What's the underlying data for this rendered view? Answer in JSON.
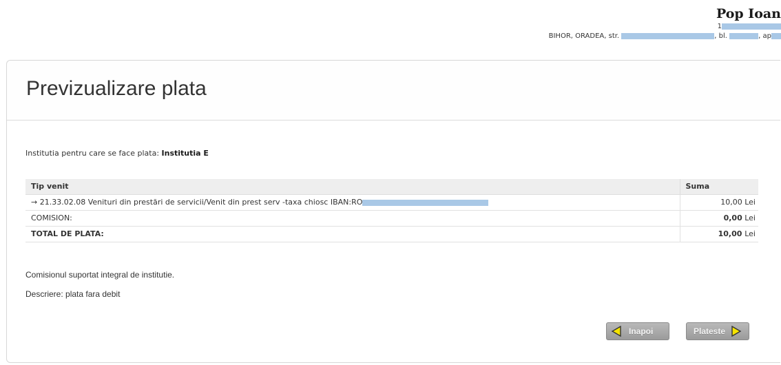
{
  "user": {
    "name": "Pop Ioan",
    "id_prefix": "1",
    "address_county_city": "BIHOR, ORADEA, str.",
    "address_bl": ", bl.",
    "address_ap": ", ap"
  },
  "page": {
    "title": "Previzualizare plata"
  },
  "institution": {
    "label": "Institutia pentru care se face plata:",
    "name": "Institutia E"
  },
  "table": {
    "headers": {
      "type": "Tip venit",
      "amount": "Suma"
    },
    "item": {
      "description": "→ 21.33.02.08 Venituri din prestări de servicii/Venit din prest serv -taxa chiosc IBAN:RO",
      "amount": "10,00",
      "currency": "Lei"
    },
    "comision": {
      "label": "COMISION:",
      "amount": "0,00",
      "currency": "Lei"
    },
    "total": {
      "label": "TOTAL DE PLATA:",
      "amount": "10,00",
      "currency": "Lei"
    }
  },
  "notes": {
    "commission_note": "Comisionul suportat integral de institutie.",
    "description": "Descriere: plata fara debit"
  },
  "buttons": {
    "back": "Inapoi",
    "pay": "Plateste"
  },
  "colors": {
    "redaction": "#a9c8e6",
    "arrow_fill": "#f5e400",
    "button_bg": "#a8a8a8"
  }
}
